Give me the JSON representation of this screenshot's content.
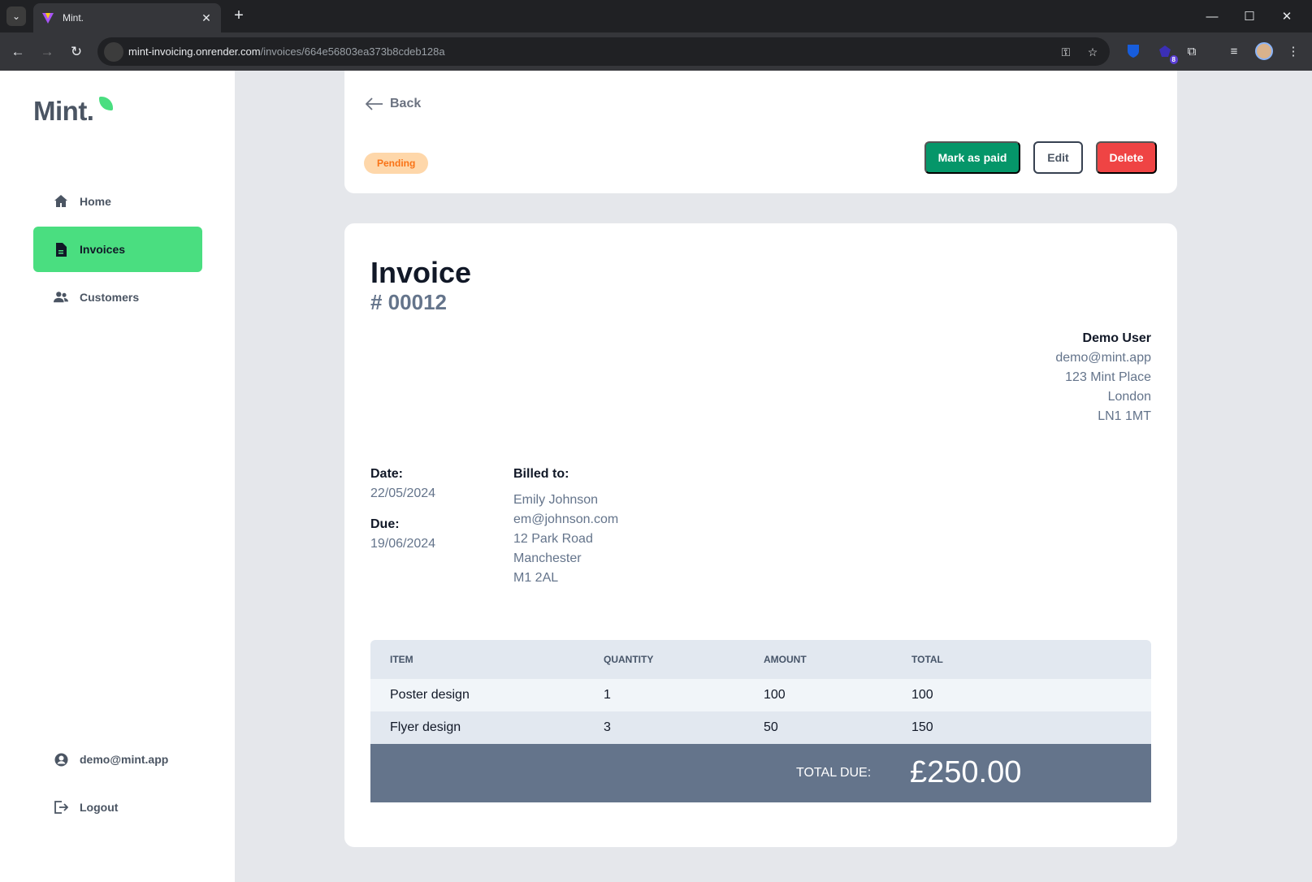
{
  "browser": {
    "tab_title": "Mint.",
    "url_host": "mint-invoicing.onrender.com",
    "url_path": "/invoices/664e56803ea373b8cdeb128a",
    "extension_badge": "8"
  },
  "sidebar": {
    "logo": "Mint.",
    "nav": [
      {
        "label": "Home",
        "icon": "home-icon"
      },
      {
        "label": "Invoices",
        "icon": "document-icon",
        "active": true
      },
      {
        "label": "Customers",
        "icon": "users-icon"
      }
    ],
    "account": {
      "label": "demo@mint.app",
      "icon": "user-circle-icon"
    },
    "logout": {
      "label": "Logout",
      "icon": "logout-icon"
    }
  },
  "header": {
    "back_label": "Back",
    "status": "Pending",
    "mark_paid_label": "Mark as paid",
    "edit_label": "Edit",
    "delete_label": "Delete"
  },
  "invoice": {
    "title": "Invoice",
    "number": "# 00012",
    "from": {
      "name": "Demo User",
      "email": "demo@mint.app",
      "address1": "123 Mint Place",
      "city": "London",
      "postcode": "LN1 1MT"
    },
    "date_label": "Date:",
    "date": "22/05/2024",
    "due_label": "Due:",
    "due": "19/06/2024",
    "billed_label": "Billed to:",
    "billed": {
      "name": "Emily Johnson",
      "email": "em@johnson.com",
      "address1": "12 Park Road",
      "city": "Manchester",
      "postcode": "M1 2AL"
    },
    "columns": [
      "ITEM",
      "QUANTITY",
      "AMOUNT",
      "TOTAL"
    ],
    "items": [
      {
        "item": "Poster design",
        "quantity": "1",
        "amount": "100",
        "total": "100"
      },
      {
        "item": "Flyer design",
        "quantity": "3",
        "amount": "50",
        "total": "150"
      }
    ],
    "total_label": "TOTAL DUE:",
    "total_amount": "£250.00"
  },
  "colors": {
    "accent": "#4ade80",
    "paid_button": "#059669",
    "delete_button": "#ef4444",
    "pending_badge_bg": "#fed7aa",
    "pending_badge_text": "#f97316",
    "total_bar": "#64748b"
  }
}
